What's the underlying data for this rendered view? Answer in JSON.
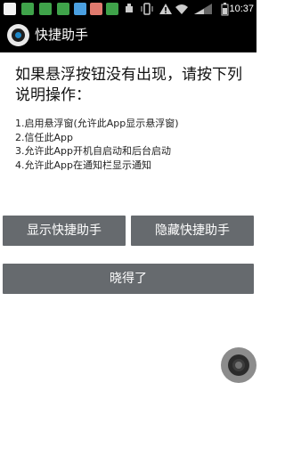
{
  "status_bar": {
    "icons": [
      "notification-icon",
      "message-icon",
      "chat-icon",
      "photo-icon",
      "weather-icon",
      "app-icon",
      "download-icon",
      "usb-icon",
      "vibrate-icon",
      "warning-icon",
      "wifi-icon",
      "signal-icon",
      "battery-icon"
    ],
    "time": "10:37"
  },
  "app_bar": {
    "title": "快捷助手"
  },
  "main": {
    "heading": "如果悬浮按钮没有出现，请按下列说明操作：",
    "steps": [
      "1.启用悬浮窗(允许此App显示悬浮窗)",
      "2.信任此App",
      "3.允许此App开机自启动和后台启动",
      "4.允许此App在通知栏显示通知"
    ]
  },
  "buttons": {
    "show": "显示快捷助手",
    "hide": "隐藏快捷助手",
    "ok": "晓得了"
  },
  "colors": {
    "button": "#666a6e",
    "bar": "#000000",
    "accent": "#1e87c8"
  }
}
